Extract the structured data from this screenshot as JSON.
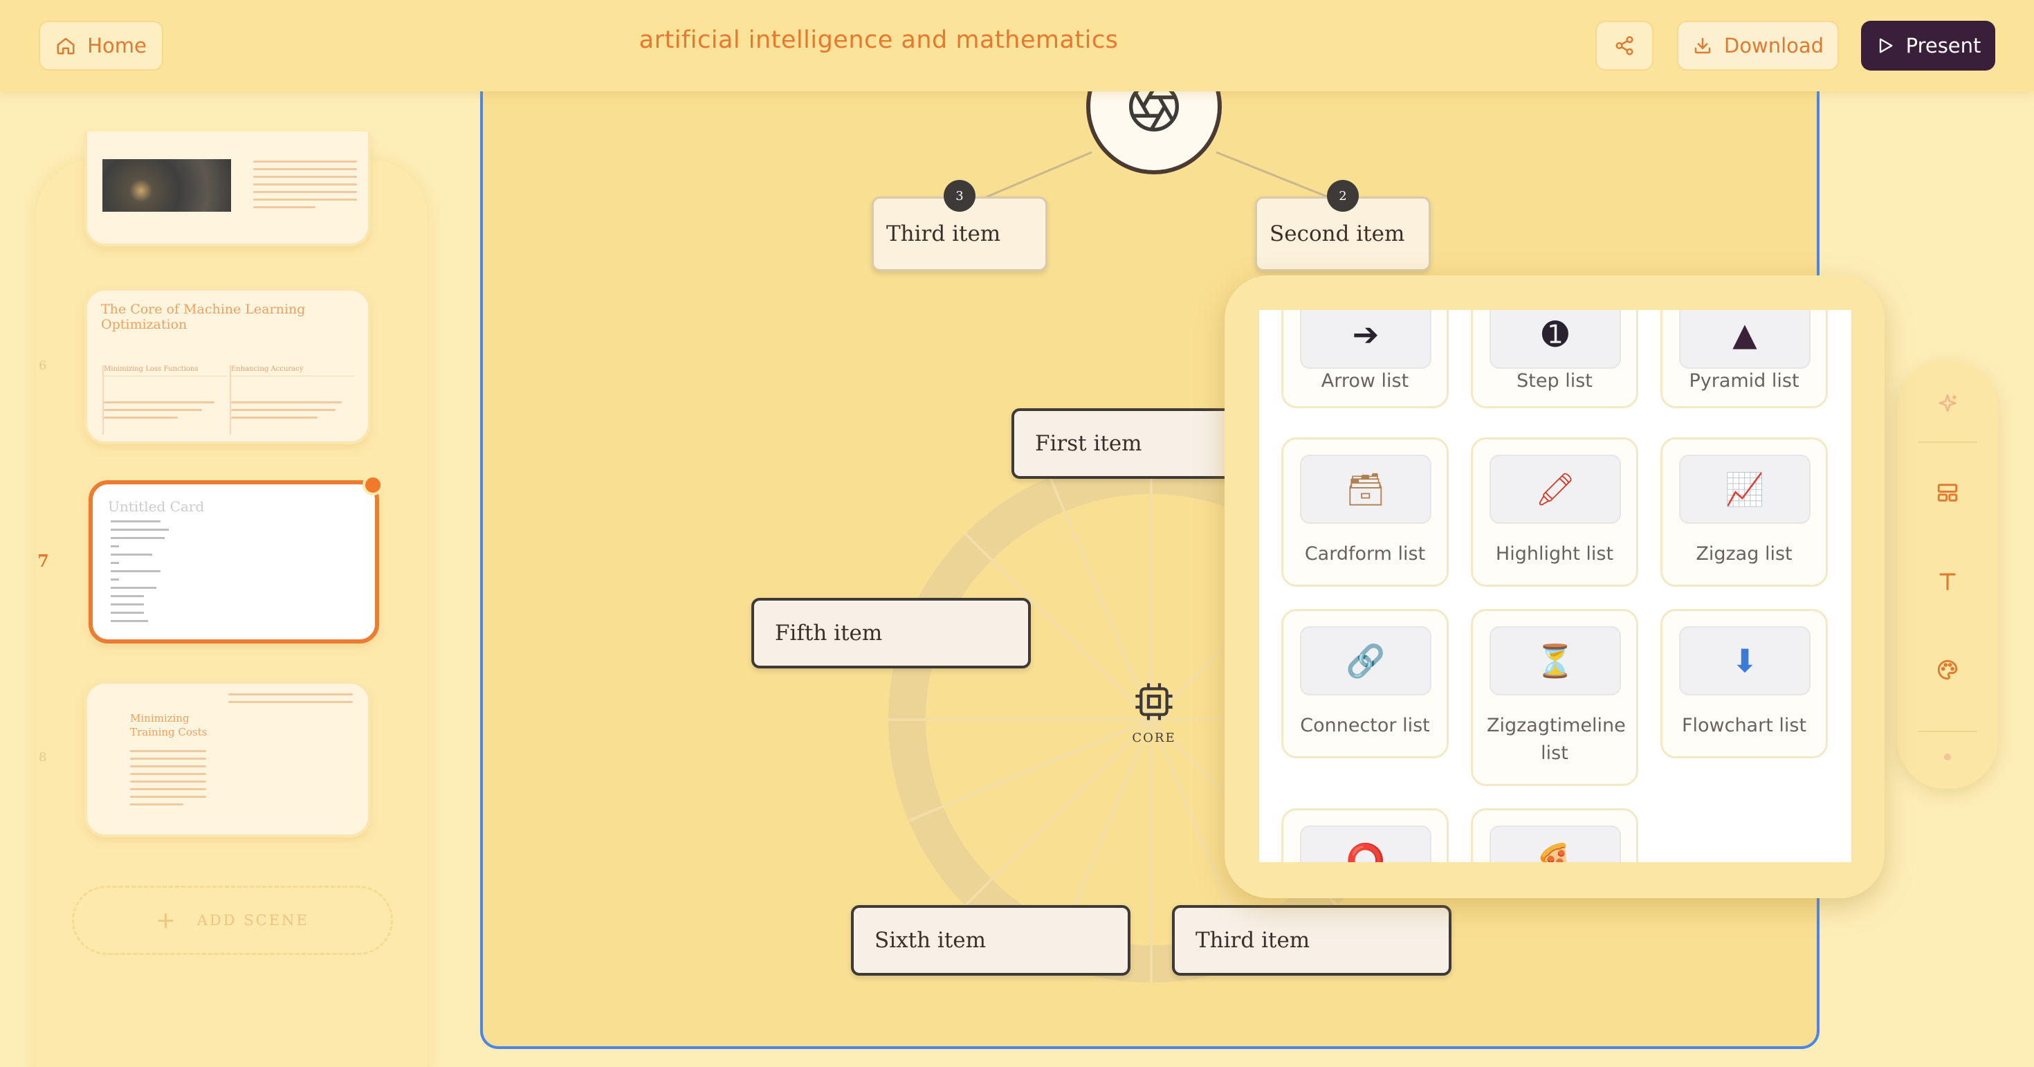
{
  "header": {
    "home_label": "Home",
    "title": "artificial intelligence and mathematics",
    "download_label": "Download",
    "present_label": "Present"
  },
  "sidebar": {
    "slides": [
      {
        "number": "",
        "title": ""
      },
      {
        "number": "6",
        "title": "The Core of Machine Learning Optimization",
        "col1": "Minimizing Loss Functions",
        "col2": "Enhancing Accuracy"
      },
      {
        "number": "7",
        "title": "Untitled Card"
      },
      {
        "number": "8",
        "title": "Minimizing Training Costs"
      }
    ],
    "add_scene_label": "ADD SCENE"
  },
  "canvas": {
    "core_label": "CORE",
    "nodes": [
      {
        "label": "Third item",
        "badge": "3"
      },
      {
        "label": "Second item",
        "badge": "2"
      },
      {
        "label": "First item"
      },
      {
        "label": "Fifth item"
      },
      {
        "label": "Sixth item"
      },
      {
        "label": "Third item"
      }
    ]
  },
  "layout_menu": {
    "items": [
      {
        "label": "Arrow list",
        "icon": "➔"
      },
      {
        "label": "Step list",
        "icon": "➊"
      },
      {
        "label": "Pyramid list",
        "icon": "▲"
      },
      {
        "label": "Cardform list",
        "icon": "🗃"
      },
      {
        "label": "Highlight list",
        "icon": "🖍"
      },
      {
        "label": "Zigzag list",
        "icon": "📈"
      },
      {
        "label": "Connector list",
        "icon": "🔗"
      },
      {
        "label": "Zigzagtimeline list",
        "icon": "⏳"
      },
      {
        "label": "Flowchart list",
        "icon": "⬇"
      },
      {
        "label": "",
        "icon": "⭕"
      },
      {
        "label": "",
        "icon": "🍕"
      }
    ]
  },
  "colors": {
    "accent": "#e9782f",
    "present_bg": "#3a1f3a",
    "canvas_bg": "#f9df92",
    "selection": "#4a86e8"
  }
}
